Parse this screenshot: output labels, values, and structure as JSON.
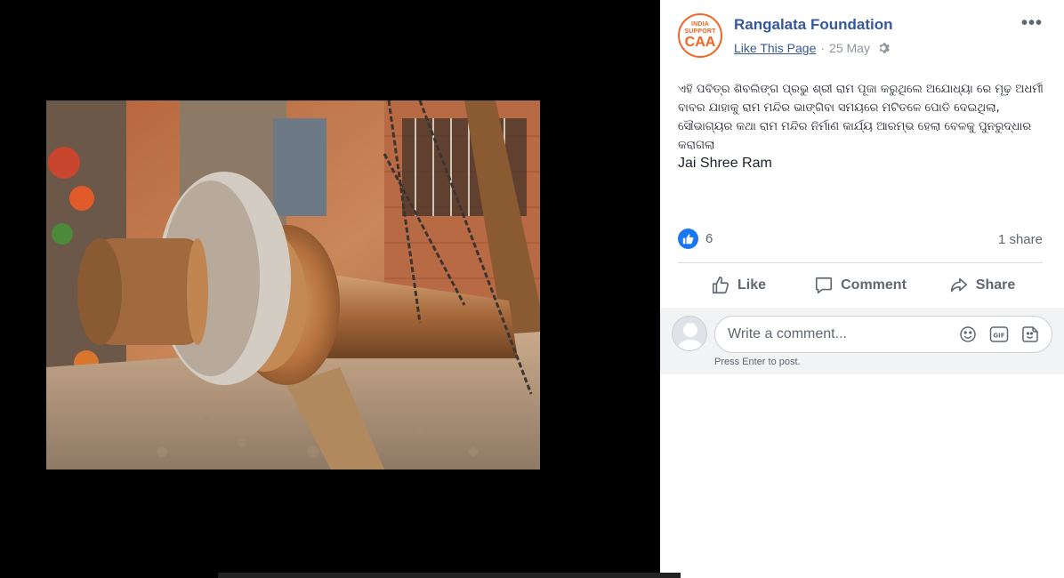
{
  "post": {
    "page_name": "Rangalata Foundation",
    "avatar": {
      "line1": "INDIA",
      "line2": "SUPPORT",
      "line3": "CAA"
    },
    "like_page_label": "Like This Page",
    "separator": "·",
    "date": "25 May",
    "more_label": "•••",
    "text_odia": "ଏହି ପବିତ୍ର ଶିବଲିଙ୍ଗ ପ୍ରଭୁ ଶ୍ରୀ ରାମ ପୂଜା କରୁଥିଲେ ଅଯୋଧ୍ୟା ରେ ମୂଢ଼ ଅଧର୍ମୀ ବାବର ଯାହାକୁ ରାମ ମନ୍ଦିର ଭାଙ୍ଗିବା ସମୟରେ ମଟିତଳେ ପୋତି ଦେଇଥିଲା, ସୌଭାଗ୍ୟର କଥା ରାମ ମନ୍ଦିର ନିର୍ମାଣ କାର୍ଯ୍ୟ ଆରମ୍ଭ ହେଲା ବେଳକୁ ପୁନରୁଦ୍ଧାର କରାଗଲା",
    "text_english": "Jai Shree Ram",
    "reaction_count": "6",
    "share_count": "1 share"
  },
  "actions": {
    "like": "Like",
    "comment": "Comment",
    "share": "Share"
  },
  "comment_box": {
    "placeholder": "Write a comment...",
    "hint": "Press Enter to post."
  },
  "colors": {
    "link_blue": "#365899",
    "avatar_orange": "#f26522",
    "like_badge": "#1877f2",
    "meta_gray": "#90949c"
  }
}
